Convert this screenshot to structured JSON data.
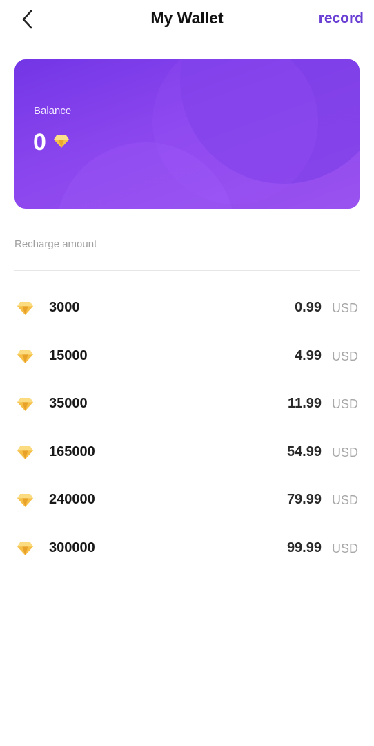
{
  "header": {
    "title": "My Wallet",
    "record_label": "record",
    "back_icon": "chevron-left-icon"
  },
  "balance": {
    "label": "Balance",
    "value": "0",
    "icon": "diamond-icon"
  },
  "recharge": {
    "section_label": "Recharge amount",
    "items": [
      {
        "amount": "3000",
        "price": "0.99",
        "currency": "USD"
      },
      {
        "amount": "15000",
        "price": "4.99",
        "currency": "USD"
      },
      {
        "amount": "35000",
        "price": "11.99",
        "currency": "USD"
      },
      {
        "amount": "165000",
        "price": "54.99",
        "currency": "USD"
      },
      {
        "amount": "240000",
        "price": "79.99",
        "currency": "USD"
      },
      {
        "amount": "300000",
        "price": "99.99",
        "currency": "USD"
      }
    ]
  },
  "colors": {
    "accent": "#6a3fd4",
    "card_gradient_start": "#7336e6",
    "card_gradient_end": "#9a52ef",
    "gem_gold": "#f5c04a"
  }
}
